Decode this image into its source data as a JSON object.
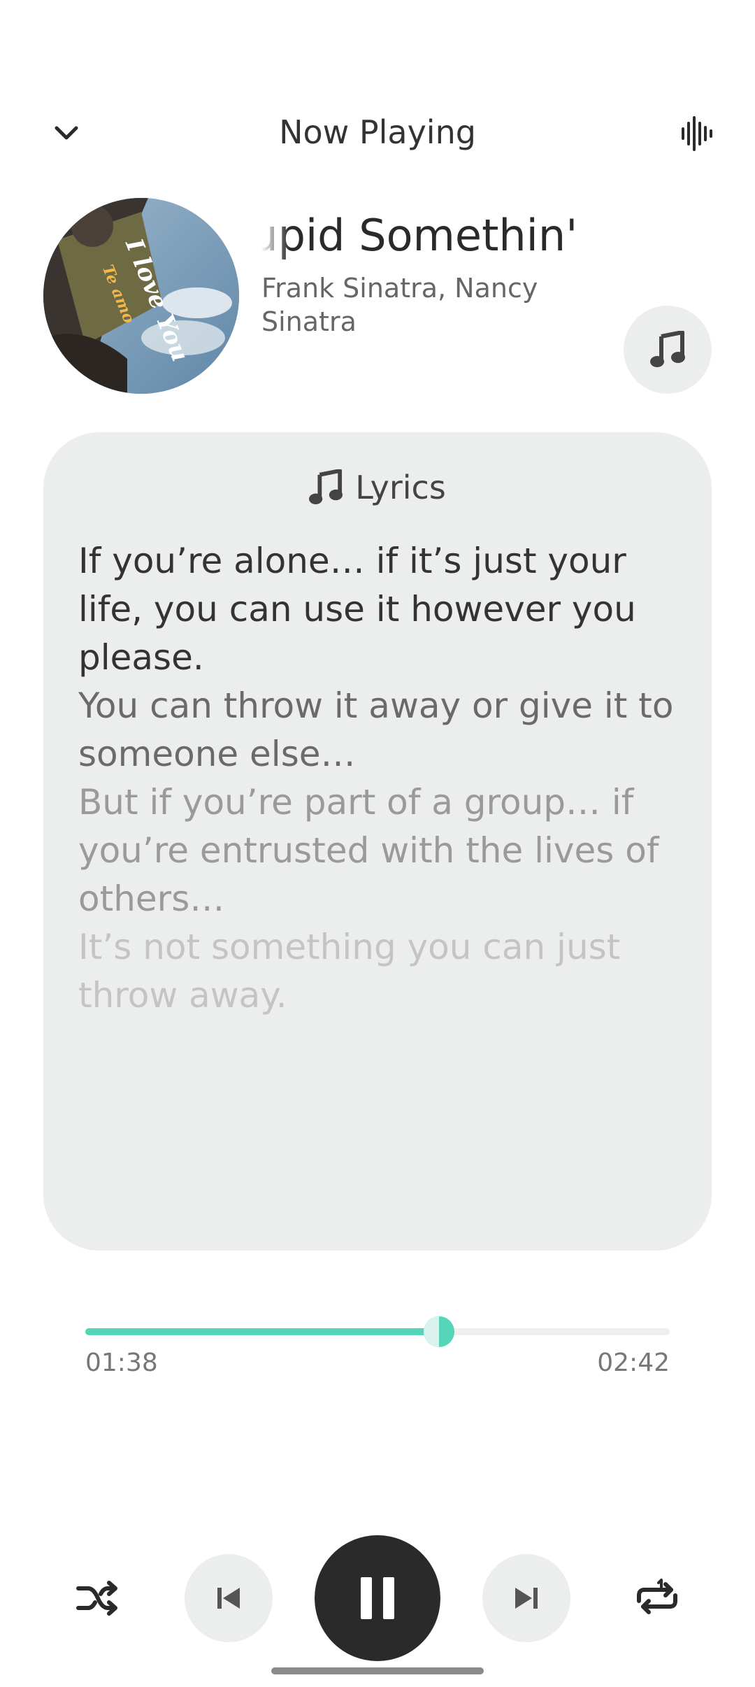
{
  "header": {
    "title": "Now Playing",
    "collapse_icon": "chevron-down-icon",
    "visualizer_icon": "audio-waveform-icon"
  },
  "track": {
    "title_visible": "tupid   Somethin'",
    "artist": "Frank Sinatra, Nancy Sinatra",
    "album_art_text": [
      "I love You",
      "Te amo"
    ]
  },
  "lyrics": {
    "label": "Lyrics",
    "icon": "music-note-icon",
    "lines": [
      "If you’re alone… if it’s just your life, you can use it however you please.",
      "You can throw it away or give it to someone else…",
      "But if you’re part of a group… if you’re entrusted with the lives of others…",
      "It’s not something you can just throw away."
    ]
  },
  "playback": {
    "current_time": "01:38",
    "total_time": "02:42",
    "progress": 0.605,
    "state": "playing"
  },
  "colors": {
    "accent": "#55d4b9",
    "card_bg": "#eceeee",
    "play_button": "#2a2a2a"
  },
  "controls": {
    "shuffle_icon": "shuffle-icon",
    "previous_icon": "skip-previous-icon",
    "pause_icon": "pause-icon",
    "next_icon": "skip-next-icon",
    "repeat_icon": "repeat-one-icon"
  }
}
